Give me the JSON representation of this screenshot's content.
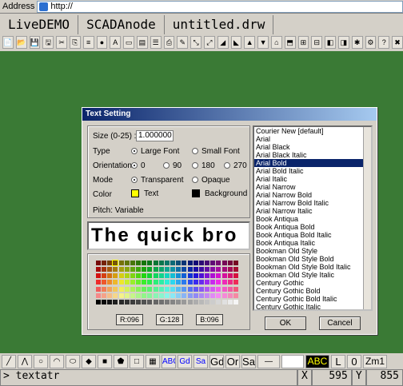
{
  "address": {
    "label": "Address",
    "url": "http://"
  },
  "titles": [
    "LiveDEMO",
    "SCADAnode",
    "untitled.drw"
  ],
  "toolbar_count": 30,
  "dialog": {
    "title": "Text Setting",
    "size_label": "Size (0-25) :",
    "size_value": "1.000000",
    "type_label": "Type",
    "type_large": "Large Font",
    "type_small": "Small Font",
    "orient_label": "Orientation",
    "o0": "0",
    "o90": "90",
    "o180": "180",
    "o270": "270",
    "mode_label": "Mode",
    "mode_trans": "Transparent",
    "mode_opaque": "Opaque",
    "color_label": "Color",
    "color_text": "Text",
    "color_bg": "Background",
    "pitch": "Pitch: Variable",
    "preview": "The quick bro",
    "r": "R:096",
    "g": "G:128",
    "b": "B:096",
    "ok": "OK",
    "cancel": "Cancel",
    "fonts": [
      "Courier New [default]",
      "Arial",
      "Arial Black",
      "Arial Black Italic",
      "Arial Bold",
      "Arial Bold Italic",
      "Arial Italic",
      "Arial Narrow",
      "Arial Narrow Bold",
      "Arial Narrow Bold Italic",
      "Arial Narrow Italic",
      "Book Antiqua",
      "Book Antiqua Bold",
      "Book Antiqua Bold Italic",
      "Book Antiqua Italic",
      "Bookman Old Style",
      "Bookman Old Style Bold",
      "Bookman Old Style Bold Italic",
      "Bookman Old Style Italic",
      "Century Gothic",
      "Century Gothic Bold",
      "Century Gothic Bold Italic",
      "Century Gothic Italic"
    ],
    "selected_font": "Arial Bold"
  },
  "bottom_toolbar": [
    "ABC",
    "Gd",
    "Sa",
    "Gd",
    "Or",
    "Sa",
    "ABC",
    "L",
    "0",
    "Zm1"
  ],
  "status": {
    "command": "> textatr",
    "x_label": "X",
    "x": "595",
    "y_label": "Y",
    "y": "855"
  },
  "colors": {
    "canvas": "#3a7a35",
    "selection": "#0a246a"
  }
}
